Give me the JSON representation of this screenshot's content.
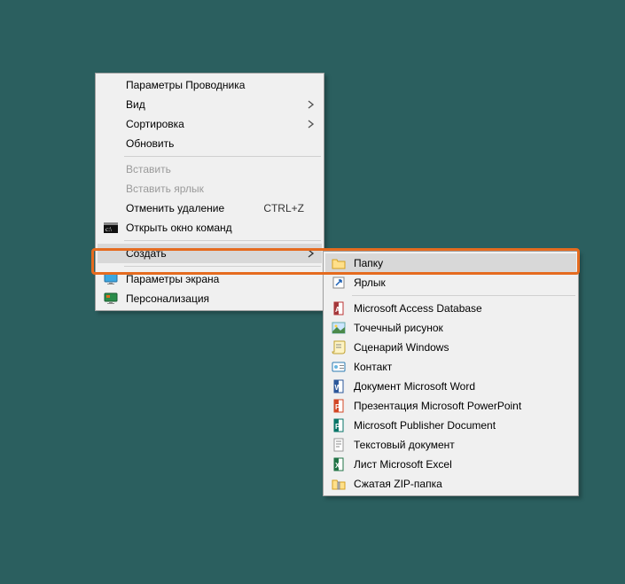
{
  "main_menu": {
    "items": [
      {
        "label": "Параметры Проводника",
        "icon": "",
        "sub": false
      },
      {
        "label": "Вид",
        "icon": "",
        "sub": true
      },
      {
        "label": "Сортировка",
        "icon": "",
        "sub": true
      },
      {
        "label": "Обновить",
        "icon": "",
        "sub": false
      },
      {
        "sep": true
      },
      {
        "label": "Вставить",
        "icon": "",
        "disabled": true
      },
      {
        "label": "Вставить ярлык",
        "icon": "",
        "disabled": true
      },
      {
        "label": "Отменить удаление",
        "icon": "",
        "shortcut": "CTRL+Z"
      },
      {
        "label": "Открыть окно команд",
        "icon": "cmd"
      },
      {
        "sep": true
      },
      {
        "label": "Создать",
        "icon": "",
        "sub": true,
        "hover": true
      },
      {
        "sep": true
      },
      {
        "label": "Параметры экрана",
        "icon": "display"
      },
      {
        "label": "Персонализация",
        "icon": "personalize"
      }
    ]
  },
  "sub_menu": {
    "items": [
      {
        "label": "Папку",
        "icon": "folder",
        "hover": true
      },
      {
        "label": "Ярлык",
        "icon": "shortcut"
      },
      {
        "sep": true
      },
      {
        "label": "Microsoft Access Database",
        "icon": "access"
      },
      {
        "label": "Точечный рисунок",
        "icon": "bitmap"
      },
      {
        "label": "Сценарий Windows",
        "icon": "script"
      },
      {
        "label": "Контакт",
        "icon": "contact"
      },
      {
        "label": "Документ Microsoft Word",
        "icon": "word"
      },
      {
        "label": "Презентация Microsoft PowerPoint",
        "icon": "powerpoint"
      },
      {
        "label": "Microsoft Publisher Document",
        "icon": "publisher"
      },
      {
        "label": "Текстовый документ",
        "icon": "text"
      },
      {
        "label": "Лист Microsoft Excel",
        "icon": "excel"
      },
      {
        "label": "Сжатая ZIP-папка",
        "icon": "zip"
      }
    ]
  }
}
